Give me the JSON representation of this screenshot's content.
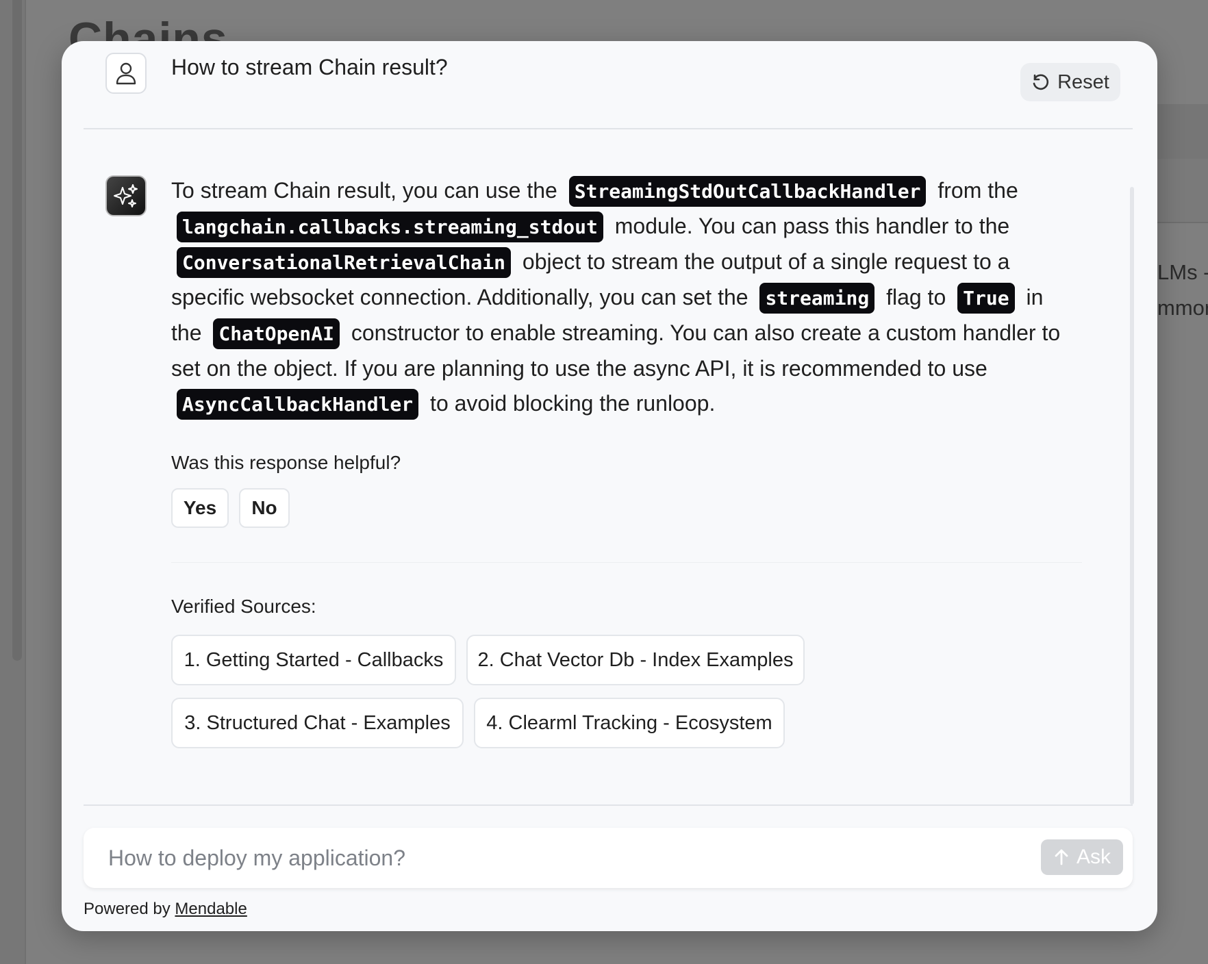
{
  "background": {
    "page_title": "Chains",
    "side_text_1": "LMs -",
    "side_text_2": "mmor"
  },
  "chat": {
    "question": "How to stream Chain result?",
    "reset_label": "Reset",
    "answer": {
      "t1": "To stream Chain result, you can use the",
      "c1": "StreamingStdOutCallbackHandler",
      "t2": "from the",
      "c2": "langchain.callbacks.streaming_stdout",
      "t3": "module. You can pass this handler to the",
      "c3": "ConversationalRetrievalChain",
      "t4": "object to stream the output of a single request to a specific websocket connection. Additionally, you can set the",
      "c4": "streaming",
      "t5": "flag to",
      "c5": "True",
      "t6": "in the",
      "c6": "ChatOpenAI",
      "t7": "constructor to enable streaming. You can also create a custom handler to set on the object. If you are planning to use the async API, it is recommended to use",
      "c7": "AsyncCallbackHandler",
      "t8": "to avoid blocking the runloop."
    },
    "feedback": {
      "question": "Was this response helpful?",
      "yes_label": "Yes",
      "no_label": "No"
    },
    "sources": {
      "title": "Verified Sources:",
      "items": [
        {
          "label": "1. Getting Started - Callbacks"
        },
        {
          "label": "2. Chat Vector Db - Index Examples"
        },
        {
          "label": "3. Structured Chat - Examples"
        },
        {
          "label": "4. Clearml Tracking - Ecosystem"
        }
      ]
    },
    "input": {
      "placeholder": "How to deploy my application?",
      "ask_label": "Ask"
    },
    "footer": {
      "powered_by": "Powered by",
      "link_text": "Mendable"
    }
  }
}
